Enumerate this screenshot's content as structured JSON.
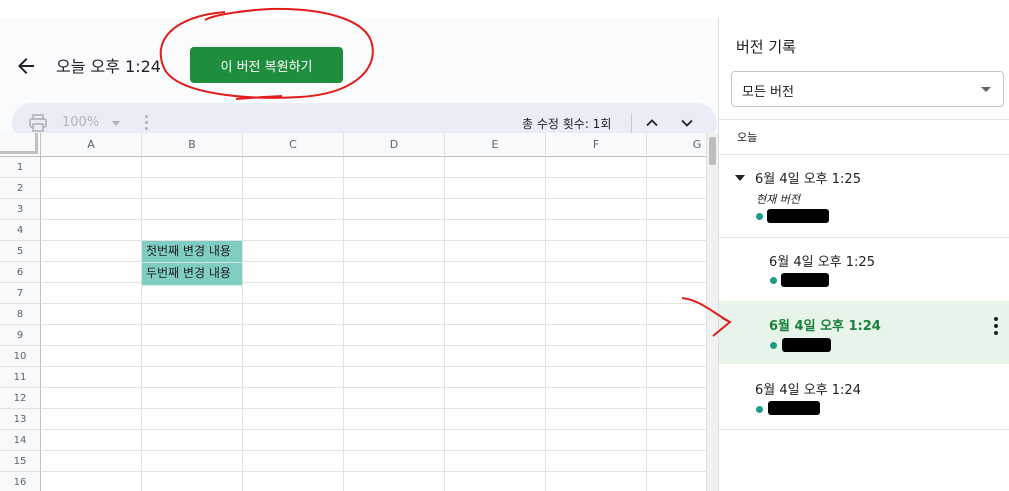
{
  "header": {
    "title": "오늘 오후 1:24",
    "restore_button": "이 버전 복원하기"
  },
  "toolbar": {
    "zoom": "100%",
    "edit_count": "총 수정 횟수: 1회"
  },
  "sheet": {
    "columns": [
      "A",
      "B",
      "C",
      "D",
      "E",
      "F",
      "G"
    ],
    "rows": [
      "1",
      "2",
      "3",
      "4",
      "5",
      "6",
      "7",
      "8",
      "9",
      "10",
      "11",
      "12",
      "13",
      "14",
      "15",
      "16"
    ],
    "cells": {
      "B5": "첫번째 변경 내용",
      "B6": "두번째 변경 내용"
    },
    "highlight_color": "#7fcdc3"
  },
  "panel": {
    "title": "버전 기록",
    "filter": "모든 버전",
    "group_label": "오늘",
    "versions": [
      {
        "time": "6월 4일 오후 1:25",
        "subtitle": "현재 버전"
      },
      {
        "time": "6월 4일 오후 1:25"
      },
      {
        "time": "6월 4일 오후 1:24",
        "selected": true
      },
      {
        "time": "6월 4일 오후 1:24"
      }
    ]
  },
  "colors": {
    "accent_green": "#1e8e3e",
    "selected_bg": "#e6f4ea",
    "selected_text": "#188038",
    "annotation_red": "#e21b1b"
  }
}
